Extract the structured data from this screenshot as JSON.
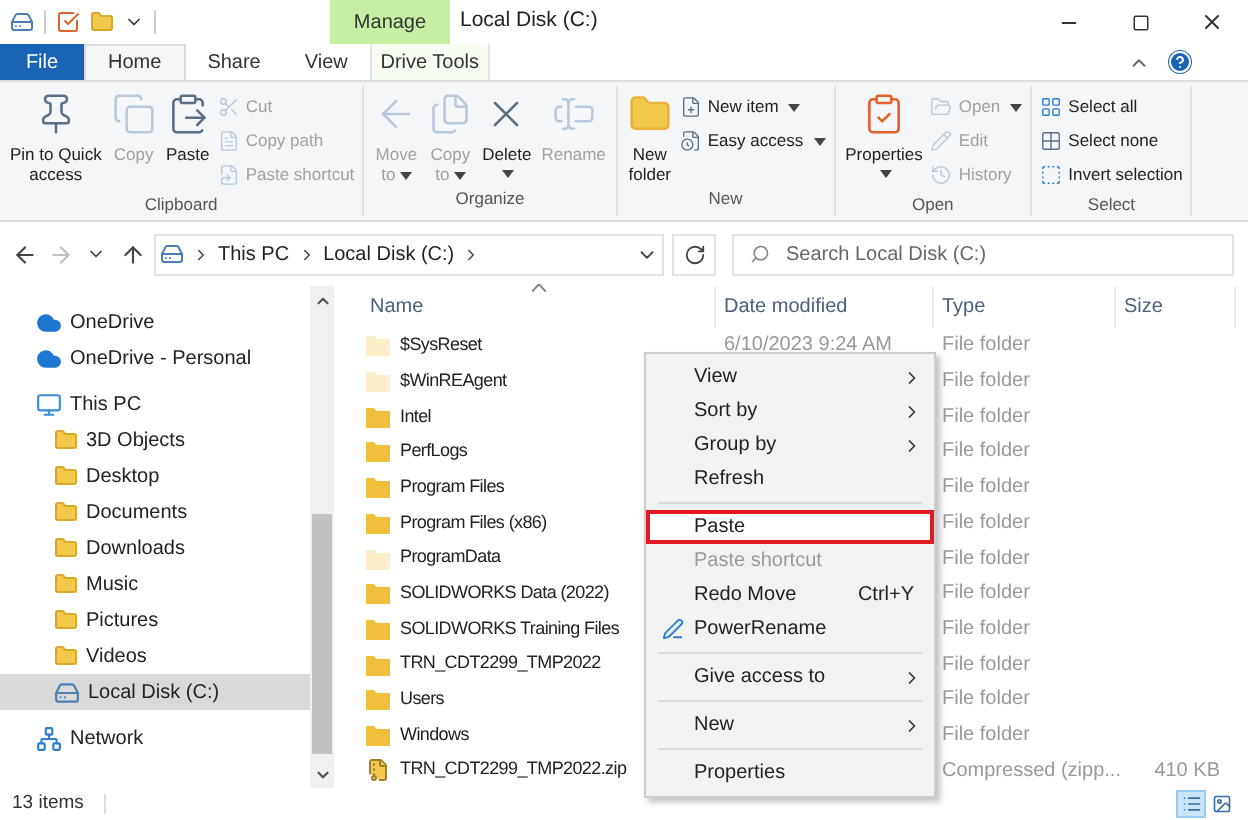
{
  "window": {
    "title": "Local Disk (C:)"
  },
  "contextual_tab": {
    "label": "Manage"
  },
  "tabs": [
    {
      "label": "File",
      "kind": "backstage",
      "selected": false
    },
    {
      "label": "Home",
      "kind": "tab",
      "selected": true
    },
    {
      "label": "Share",
      "kind": "tab",
      "selected": false
    },
    {
      "label": "View",
      "kind": "tab",
      "selected": false
    },
    {
      "label": "Drive Tools",
      "kind": "tab",
      "selected": false
    }
  ],
  "ribbon": [
    {
      "label": "Clipboard",
      "items": [
        {
          "kind": "large",
          "lines": [
            "Pin to Quick",
            "access"
          ],
          "disabled": false,
          "dropdown": false
        },
        {
          "kind": "large",
          "lines": [
            "Copy"
          ],
          "disabled": true,
          "dropdown": false
        },
        {
          "kind": "large",
          "lines": [
            "Paste"
          ],
          "disabled": false,
          "dropdown": false
        },
        {
          "kind": "small",
          "lines": [
            "Cut"
          ],
          "disabled": true,
          "dropdown": false
        },
        {
          "kind": "small",
          "lines": [
            "Copy path"
          ],
          "disabled": true,
          "dropdown": false
        },
        {
          "kind": "small",
          "lines": [
            "Paste shortcut"
          ],
          "disabled": true,
          "dropdown": false
        }
      ]
    },
    {
      "label": "Organize",
      "items": [
        {
          "kind": "large",
          "lines": [
            "Move",
            "to"
          ],
          "disabled": true,
          "dropdown": true
        },
        {
          "kind": "large",
          "lines": [
            "Copy",
            "to"
          ],
          "disabled": true,
          "dropdown": true
        },
        {
          "kind": "large",
          "lines": [
            "Delete"
          ],
          "disabled": false,
          "dropdown": true
        },
        {
          "kind": "large",
          "lines": [
            "Rename"
          ],
          "disabled": true,
          "dropdown": false
        }
      ]
    },
    {
      "label": "New",
      "items": [
        {
          "kind": "large",
          "lines": [
            "New",
            "folder"
          ],
          "disabled": false,
          "dropdown": false
        },
        {
          "kind": "small",
          "lines": [
            "New item"
          ],
          "disabled": false,
          "dropdown": true
        },
        {
          "kind": "small",
          "lines": [
            "Easy access"
          ],
          "disabled": false,
          "dropdown": true
        }
      ]
    },
    {
      "label": "Open",
      "items": [
        {
          "kind": "large",
          "lines": [
            "Properties"
          ],
          "disabled": false,
          "dropdown": true
        },
        {
          "kind": "small",
          "lines": [
            "Open"
          ],
          "disabled": true,
          "dropdown": true
        },
        {
          "kind": "small",
          "lines": [
            "Edit"
          ],
          "disabled": true,
          "dropdown": false
        },
        {
          "kind": "small",
          "lines": [
            "History"
          ],
          "disabled": true,
          "dropdown": false
        }
      ]
    },
    {
      "label": "Select",
      "items": [
        {
          "kind": "small",
          "lines": [
            "Select all"
          ],
          "disabled": false,
          "dropdown": false
        },
        {
          "kind": "small",
          "lines": [
            "Select none"
          ],
          "disabled": false,
          "dropdown": false
        },
        {
          "kind": "small",
          "lines": [
            "Invert selection"
          ],
          "disabled": false,
          "dropdown": false
        }
      ]
    }
  ],
  "nav_buttons": [
    {
      "kind": "back",
      "disabled": false
    },
    {
      "kind": "forward",
      "disabled": true
    },
    {
      "kind": "recent",
      "disabled": false
    },
    {
      "kind": "up",
      "disabled": false
    }
  ],
  "breadcrumb": [
    "This PC",
    "Local Disk (C:)"
  ],
  "search": {
    "placeholder": "Search Local Disk (C:)"
  },
  "sidebar": {
    "items": [
      {
        "label": "OneDrive",
        "kind": "cloud",
        "selected": false
      },
      {
        "label": "OneDrive - Personal",
        "kind": "cloud",
        "selected": false
      },
      {
        "label": "This PC",
        "kind": "pc",
        "selected": false,
        "children": [
          {
            "label": "3D Objects",
            "kind": "folder",
            "selected": false
          },
          {
            "label": "Desktop",
            "kind": "folder",
            "selected": false
          },
          {
            "label": "Documents",
            "kind": "folder",
            "selected": false
          },
          {
            "label": "Downloads",
            "kind": "folder",
            "selected": false
          },
          {
            "label": "Music",
            "kind": "folder",
            "selected": false
          },
          {
            "label": "Pictures",
            "kind": "folder",
            "selected": false
          },
          {
            "label": "Videos",
            "kind": "folder",
            "selected": false
          },
          {
            "label": "Local Disk (C:)",
            "kind": "drive",
            "selected": true
          }
        ]
      },
      {
        "label": "Network",
        "kind": "network",
        "selected": false
      }
    ]
  },
  "table": {
    "columns": [
      {
        "label": "Name",
        "sorted": true
      },
      {
        "label": "Date modified",
        "sorted": false
      },
      {
        "label": "Type",
        "sorted": false
      },
      {
        "label": "Size",
        "sorted": false
      }
    ],
    "rows": [
      {
        "name": "$SysReset",
        "date": "6/10/2023 9:24 AM",
        "type": "File folder",
        "kind": "folder",
        "hidden": true
      },
      {
        "name": "$WinREAgent",
        "type": "File folder",
        "kind": "folder",
        "hidden": true
      },
      {
        "name": "Intel",
        "type": "File folder",
        "kind": "folder",
        "hidden": false
      },
      {
        "name": "PerfLogs",
        "type": "File folder",
        "kind": "folder",
        "hidden": false
      },
      {
        "name": "Program Files",
        "type": "File folder",
        "kind": "folder",
        "hidden": false
      },
      {
        "name": "Program Files (x86)",
        "type": "File folder",
        "kind": "folder",
        "hidden": false
      },
      {
        "name": "ProgramData",
        "type": "File folder",
        "kind": "folder",
        "hidden": true
      },
      {
        "name": "SOLIDWORKS Data (2022)",
        "type": "File folder",
        "kind": "folder",
        "hidden": false
      },
      {
        "name": "SOLIDWORKS Training Files",
        "type": "File folder",
        "kind": "folder",
        "hidden": false
      },
      {
        "name": "TRN_CDT2299_TMP2022",
        "type": "File folder",
        "kind": "folder",
        "hidden": false
      },
      {
        "name": "Users",
        "type": "File folder",
        "kind": "folder",
        "hidden": false
      },
      {
        "name": "Windows",
        "type": "File folder",
        "kind": "folder",
        "hidden": false
      },
      {
        "name": "TRN_CDT2299_TMP2022.zip",
        "type": "Compressed (zipp...",
        "size": "410 KB",
        "kind": "zip"
      }
    ]
  },
  "context_menu": [
    {
      "kind": "item",
      "label": "View",
      "submenu": true,
      "disabled": false,
      "outlined": false
    },
    {
      "kind": "item",
      "label": "Sort by",
      "submenu": true,
      "disabled": false,
      "outlined": false
    },
    {
      "kind": "item",
      "label": "Group by",
      "submenu": true,
      "disabled": false,
      "outlined": false
    },
    {
      "kind": "item",
      "label": "Refresh",
      "submenu": false,
      "disabled": false,
      "outlined": false
    },
    {
      "kind": "separator"
    },
    {
      "kind": "item",
      "label": "Paste",
      "submenu": false,
      "disabled": false,
      "outlined": true
    },
    {
      "kind": "item",
      "label": "Paste shortcut",
      "submenu": false,
      "disabled": true,
      "outlined": false
    },
    {
      "kind": "item",
      "label": "Redo Move",
      "shortcut": "Ctrl+Y",
      "submenu": false,
      "disabled": false,
      "outlined": false
    },
    {
      "kind": "app",
      "label": "PowerRename",
      "submenu": false,
      "disabled": false,
      "outlined": false
    },
    {
      "kind": "separator"
    },
    {
      "kind": "item",
      "label": "Give access to",
      "submenu": true,
      "disabled": false,
      "outlined": false
    },
    {
      "kind": "separator"
    },
    {
      "kind": "item",
      "label": "New",
      "submenu": true,
      "disabled": false,
      "outlined": false
    },
    {
      "kind": "separator"
    },
    {
      "kind": "item",
      "label": "Properties",
      "submenu": false,
      "disabled": false,
      "outlined": false
    }
  ],
  "status_bar": {
    "item_count": "13 items",
    "views": [
      {
        "kind": "details",
        "selected": true
      },
      {
        "kind": "tiles",
        "selected": false
      }
    ]
  }
}
